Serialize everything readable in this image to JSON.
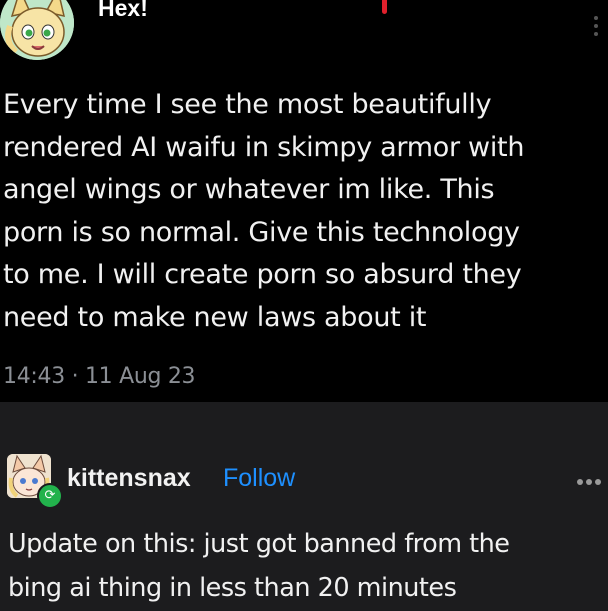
{
  "tweet": {
    "author_name": "Hex!",
    "text_lines": [
      "Every time I see the most beautifully",
      "rendered AI waifu in skimpy armor with",
      "angel wings or whatever im like. This",
      "porn is so normal. Give this technology",
      "to me. I will create porn so absurd they",
      "need to make new laws about it"
    ],
    "timestamp": "14:43 · 11 Aug 23"
  },
  "post": {
    "username": "kittensnax",
    "follow_label": "Follow",
    "reblog_icon": "reblog-icon",
    "text_lines": [
      "Update on this: just got banned from the",
      "bing ai thing in less than 20 minutes"
    ]
  },
  "colors": {
    "tweet_bg": "#000000",
    "post_bg": "#1c1c1e",
    "follow_blue": "#1e90ff",
    "reblog_green": "#22b24c",
    "timestamp_gray": "#8b8f95"
  }
}
